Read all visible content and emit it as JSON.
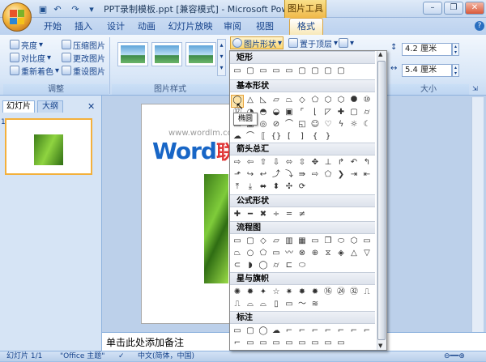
{
  "window": {
    "title": "PPT录制模板.ppt [兼容模式] - Microsoft PowerP...",
    "context_tab_group": "图片工具"
  },
  "tabs": [
    "开始",
    "插入",
    "设计",
    "动画",
    "幻灯片放映",
    "审阅",
    "视图",
    "格式"
  ],
  "ribbon": {
    "adjust": {
      "label": "调整",
      "buttons": [
        "亮度",
        "对比度",
        "重新着色",
        "压缩图片",
        "更改图片",
        "重设图片"
      ]
    },
    "picture_styles": {
      "label": "图片样式"
    },
    "arrange": {
      "shape_button": "图片形状",
      "bring_front": "置于顶层"
    },
    "size": {
      "label": "大小",
      "height": "4.2 厘米",
      "width": "5.4 厘米"
    }
  },
  "left_pane": {
    "tabs": [
      "幻灯片",
      "大纲"
    ],
    "slide_number": "1"
  },
  "watermark": {
    "site": "www.wordlm.com",
    "brand": "Word",
    "brand_cn": "联盟"
  },
  "notes_placeholder": "单击此处添加备注",
  "status": {
    "slide": "幻灯片 1/1",
    "theme": "\"Office 主题\"",
    "language": "中文(简体，中国)"
  },
  "gallery": {
    "sections": [
      "矩形",
      "基本形状",
      "箭头总汇",
      "公式形状",
      "流程图",
      "星与旗帜",
      "标注"
    ],
    "tooltip": "椭圆"
  }
}
